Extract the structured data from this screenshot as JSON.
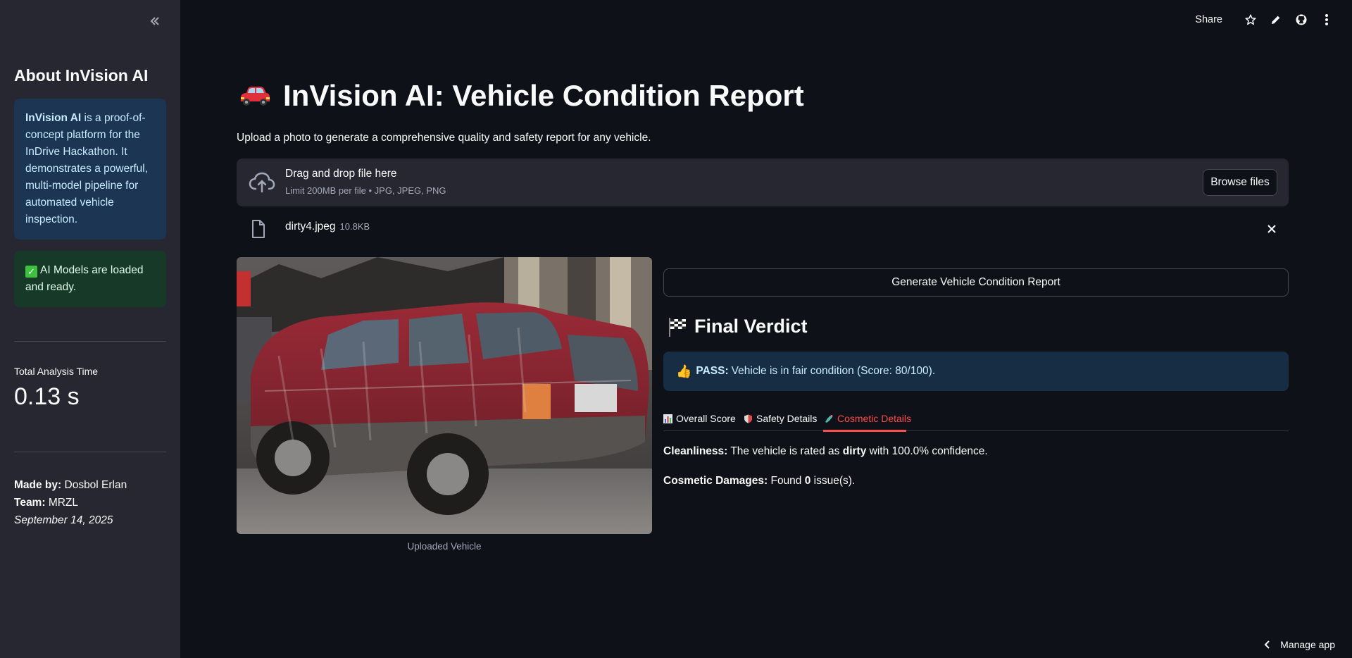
{
  "sidebar": {
    "title": "About InVision AI",
    "info": {
      "brand": "InVision AI",
      "text": " is a proof-of-concept platform for the InDrive Hackathon. It demonstrates a powerful, multi-model pipeline for automated vehicle inspection."
    },
    "status": "AI Models are loaded and ready.",
    "metric_label": "Total Analysis Time",
    "metric_value": "0.13 s",
    "made_by_label": "Made by:",
    "made_by_value": "Dosbol Erlan",
    "team_label": "Team:",
    "team_value": "MRZL",
    "date": "September 14, 2025"
  },
  "header": {
    "share_label": "Share"
  },
  "main": {
    "title": "InVision AI: Vehicle Condition Report",
    "subtitle": "Upload a photo to generate a comprehensive quality and safety report for any vehicle.",
    "uploader": {
      "drag_text": "Drag and drop file here",
      "limit_text": "Limit 200MB per file • JPG, JPEG, PNG",
      "browse_label": "Browse files"
    },
    "file": {
      "name": "dirty4.jpeg",
      "size": "10.8KB"
    },
    "image_caption": "Uploaded Vehicle",
    "generate_label": "Generate Vehicle Condition Report",
    "verdict_title": "Final Verdict",
    "verdict": {
      "status": "PASS:",
      "text": "Vehicle is in fair condition (Score: 80/100)."
    },
    "tabs": [
      {
        "label": "Overall Score"
      },
      {
        "label": "Safety Details"
      },
      {
        "label": "Cosmetic Details"
      }
    ],
    "cleanliness": {
      "label": "Cleanliness:",
      "pre": " The vehicle is rated as ",
      "value": "dirty",
      "post": " with 100.0% confidence."
    },
    "damages": {
      "label": "Cosmetic Damages:",
      "pre": " Found ",
      "value": "0",
      "post": " issue(s)."
    }
  },
  "footer": {
    "manage_label": "Manage app"
  }
}
